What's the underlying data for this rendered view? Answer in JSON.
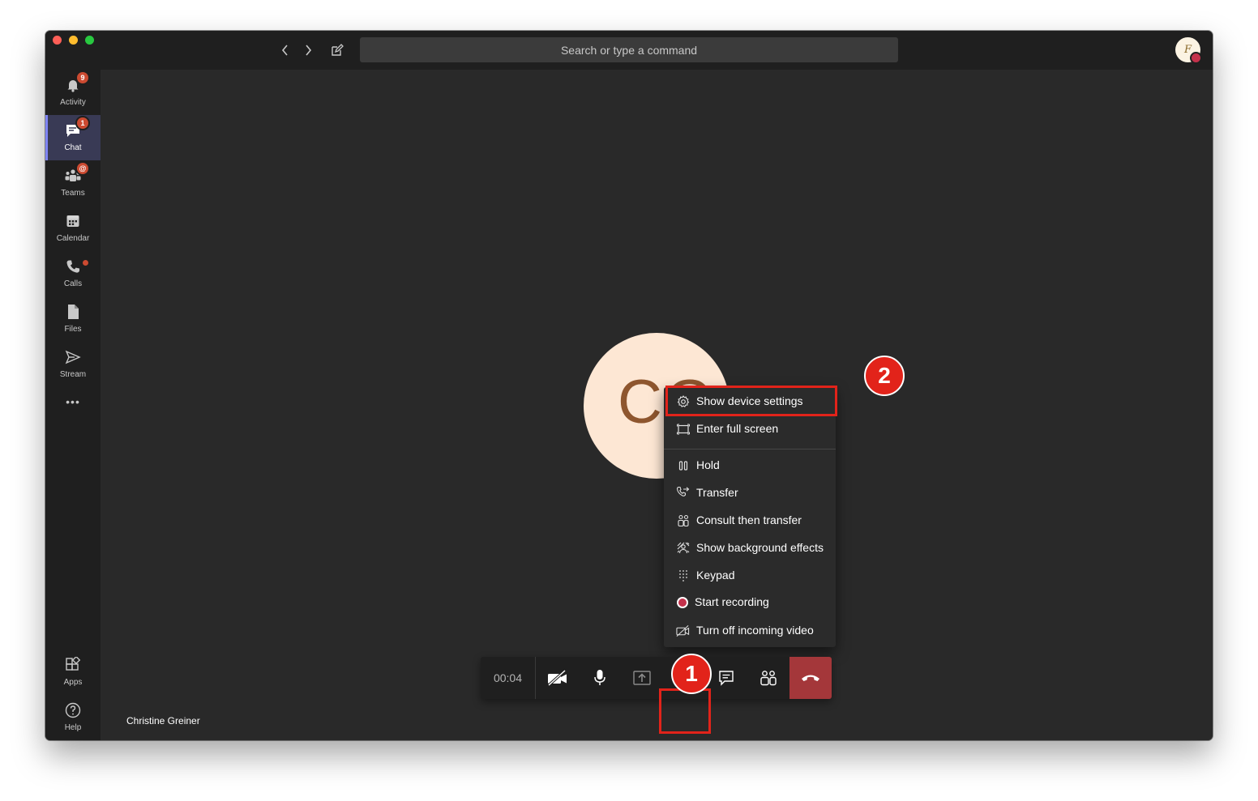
{
  "window": {
    "search_placeholder": "Search or type a command",
    "profile_initials": "F"
  },
  "sidebar": {
    "items": [
      {
        "label": "Activity",
        "icon": "bell-icon",
        "badge": "9"
      },
      {
        "label": "Chat",
        "icon": "chat-icon",
        "badge": "1",
        "active": true
      },
      {
        "label": "Teams",
        "icon": "teams-icon",
        "badge": "@"
      },
      {
        "label": "Calendar",
        "icon": "calendar-icon"
      },
      {
        "label": "Calls",
        "icon": "phone-icon",
        "dot": true
      },
      {
        "label": "Files",
        "icon": "file-icon"
      },
      {
        "label": "Stream",
        "icon": "stream-icon"
      }
    ],
    "more": "•••",
    "bottom": [
      {
        "label": "Apps",
        "icon": "apps-icon"
      },
      {
        "label": "Help",
        "icon": "help-icon"
      }
    ]
  },
  "call": {
    "avatar_initials": "CG",
    "caller_name": "Christine Greiner",
    "timer": "00:04"
  },
  "menu": {
    "items": [
      {
        "label": "Show device settings",
        "icon": "gear-icon"
      },
      {
        "label": "Enter full screen",
        "icon": "fullscreen-icon"
      },
      {
        "label": "Hold",
        "icon": "pause-icon"
      },
      {
        "label": "Transfer",
        "icon": "transfer-icon"
      },
      {
        "label": "Consult then transfer",
        "icon": "consult-icon"
      },
      {
        "label": "Show background effects",
        "icon": "background-effects-icon"
      },
      {
        "label": "Keypad",
        "icon": "keypad-icon"
      },
      {
        "label": "Start recording",
        "icon": "record-icon"
      },
      {
        "label": "Turn off incoming video",
        "icon": "video-off-icon"
      }
    ]
  },
  "annotations": {
    "step1": "1",
    "step2": "2"
  },
  "colors": {
    "accent": "#7f85f5",
    "hangup": "#a4373a",
    "annotation": "#e2231a",
    "badge": "#cc4a31"
  }
}
